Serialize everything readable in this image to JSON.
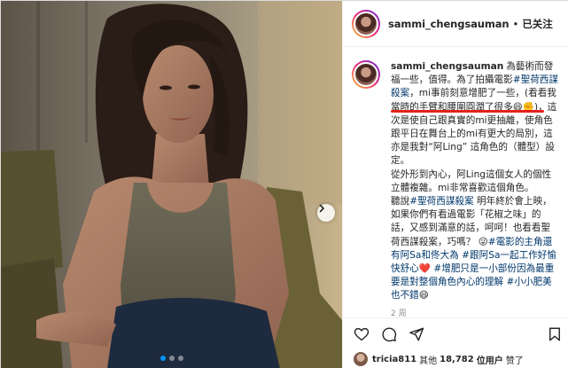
{
  "header": {
    "username": "sammi_chengsauman",
    "separator": "•",
    "follow_status": "已关注"
  },
  "caption": {
    "username": "sammi_chengsauman",
    "segments": [
      {
        "text": "為藝術而發福一些，值得。為了拍攝電影",
        "tag": false
      },
      {
        "text": "#聖荷西謀殺案",
        "tag": true
      },
      {
        "text": "，mi事前刻意增肥了一些，(看看我當時的手臂和腰圍圓潤了很多😄",
        "tag": false
      },
      {
        "text": "✊)，這次是使自己跟真實的mi更抽離，使角色跟平日在舞台上的mi有更大的局別，這亦是我對“阿Ling” 這角色的（體型）設定。",
        "tag": false
      },
      {
        "text": "\n從外形到內心，阿Ling這個女人的個性立體複雜。mi非常喜歡這個角色。",
        "tag": false
      },
      {
        "text": "\n聽說",
        "tag": false
      },
      {
        "text": "#聖荷西謀殺案",
        "tag": true
      },
      {
        "text": " 明年終於會上映，如果你們有看過電影「花椒之味」的話，又感到滿意的話，呵呵！也看看聖荷西謀殺案，巧嗎？ 😜",
        "tag": false
      },
      {
        "text": "#電影的主角還有阿Sa和佟大為",
        "tag": true
      },
      {
        "text": " ",
        "tag": false
      },
      {
        "text": "#跟阿Sa一起工作好愉快舒心",
        "tag": true
      },
      {
        "text": "❤️ ",
        "tag": false
      },
      {
        "text": "#增肥只是一小部份因為最重要是對整個角色內心的理解",
        "tag": true
      },
      {
        "text": " ",
        "tag": false
      },
      {
        "text": "#小小肥美也不錯",
        "tag": true
      },
      {
        "text": "😄",
        "tag": false
      }
    ],
    "time_ago": "2 周"
  },
  "likes": {
    "liker": "tricia811",
    "and": "其他",
    "count": "18,782",
    "suffix": "位用户",
    "liked": "赞了"
  },
  "photo": {
    "slides": 3,
    "active_slide": 1
  },
  "colors": {
    "link": "#00376b",
    "active_dot": "#0095f6",
    "heart": "#ed4956",
    "annotation_line": "#e2231a",
    "muted_text": "#8e8e8e"
  },
  "icons": [
    "heart-icon",
    "comment-icon",
    "share-icon",
    "bookmark-icon",
    "chevron-right-icon"
  ]
}
